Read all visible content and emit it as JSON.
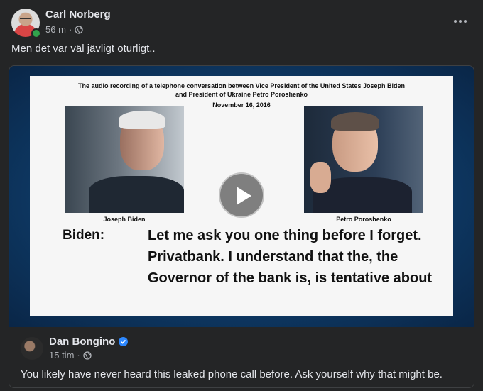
{
  "post": {
    "author": "Carl Norberg",
    "time": "56 m",
    "separator": "·",
    "text": "Men det var väl jävligt oturligt..",
    "more_icon": "more-horizontal-icon",
    "audience_icon": "globe-icon"
  },
  "shared": {
    "slide": {
      "title_line1": "The audio recording of a telephone conversation between Vice President of the United States Joseph Biden",
      "title_line2": "and President of Ukraine Petro Poroshenko",
      "date": "November 16, 2016",
      "caption_left": "Joseph Biden",
      "caption_right": "Petro Poroshenko",
      "speaker": "Biden:",
      "quote": "Let me ask you one thing before I forget. Privatbank. I understand that the, the Governor of the bank is, is tentative about"
    },
    "author": "Dan Bongino",
    "verified_icon": "verified-badge-icon",
    "time": "15 tim",
    "separator": "·",
    "text": "You likely have never heard this leaked phone call before. Ask yourself why that might be."
  },
  "colors": {
    "background": "#242526",
    "text_primary": "#e4e6eb",
    "text_secondary": "#b0b3b8",
    "online": "#31a24c",
    "verified": "#2d88ff"
  }
}
